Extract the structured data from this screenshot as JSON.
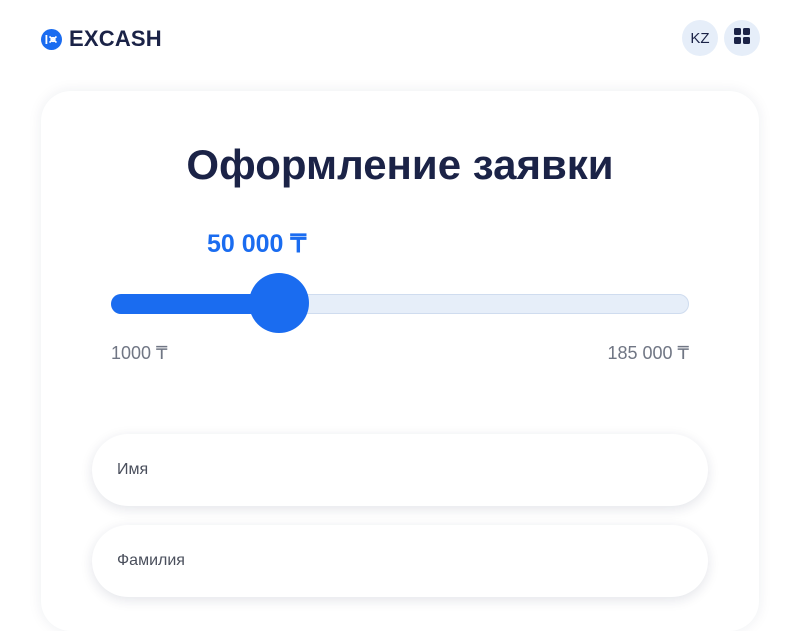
{
  "header": {
    "logo_text": "EXCASH",
    "lang_label": "KZ",
    "menu_icon": "grid-icon",
    "brand_color": "#1a6cf0"
  },
  "form": {
    "title": "Оформление заявки",
    "amount_display": "50 000 ₸",
    "slider": {
      "min": 1000,
      "max": 185000,
      "value": 50000,
      "min_label": "1000 ₸",
      "max_label": "185 000 ₸"
    },
    "first_name": {
      "placeholder": "Имя",
      "value": ""
    },
    "last_name": {
      "placeholder": "Фамилия",
      "value": ""
    }
  }
}
